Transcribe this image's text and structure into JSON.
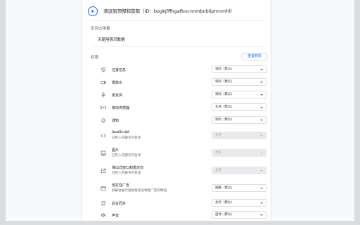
{
  "header": {
    "title": "清运到顶部和首部（ID：bogkjfffhgafbncnnmbnblipmnmhl）"
  },
  "usage": {
    "label": "空间占用量",
    "text": "无使用情况数据"
  },
  "permissions": {
    "label": "权限",
    "reset_label": "重置权限",
    "items": [
      {
        "icon": "location-icon",
        "label": "位置信息",
        "sub": "",
        "value": "询问（默认）",
        "disabled": false
      },
      {
        "icon": "camera-icon",
        "label": "摄像头",
        "sub": "",
        "value": "询问（默认）",
        "disabled": false
      },
      {
        "icon": "microphone-icon",
        "label": "麦克风",
        "sub": "",
        "value": "询问（默认）",
        "disabled": false
      },
      {
        "icon": "motion-sensor-icon",
        "label": "移动传感器",
        "sub": "",
        "value": "允许（默认）",
        "disabled": false
      },
      {
        "icon": "bell-icon",
        "label": "通知",
        "sub": "",
        "value": "询问（默认）",
        "disabled": false
      },
      {
        "icon": "code-icon",
        "label": "JavaScript",
        "sub": "已列入内部许可名单",
        "value": "允许",
        "disabled": true
      },
      {
        "icon": "image-icon",
        "label": "图片",
        "sub": "已列入内部许可名单",
        "value": "允许",
        "disabled": true
      },
      {
        "icon": "popup-icon",
        "label": "弹出式窗口和重定向",
        "sub": "已列入内部许可名单",
        "value": "允许",
        "disabled": true
      },
      {
        "icon": "ad-icon",
        "label": "侵扰性广告",
        "sub": "屏蔽会展示侵扰性或误导性广告的网站",
        "value": "屏蔽（默认）",
        "disabled": false
      },
      {
        "icon": "sync-icon",
        "label": "后台同步",
        "sub": "",
        "value": "允许（默认）",
        "disabled": false
      },
      {
        "icon": "sound-icon",
        "label": "声音",
        "sub": "",
        "value": "自动（默认）",
        "disabled": false
      }
    ]
  }
}
